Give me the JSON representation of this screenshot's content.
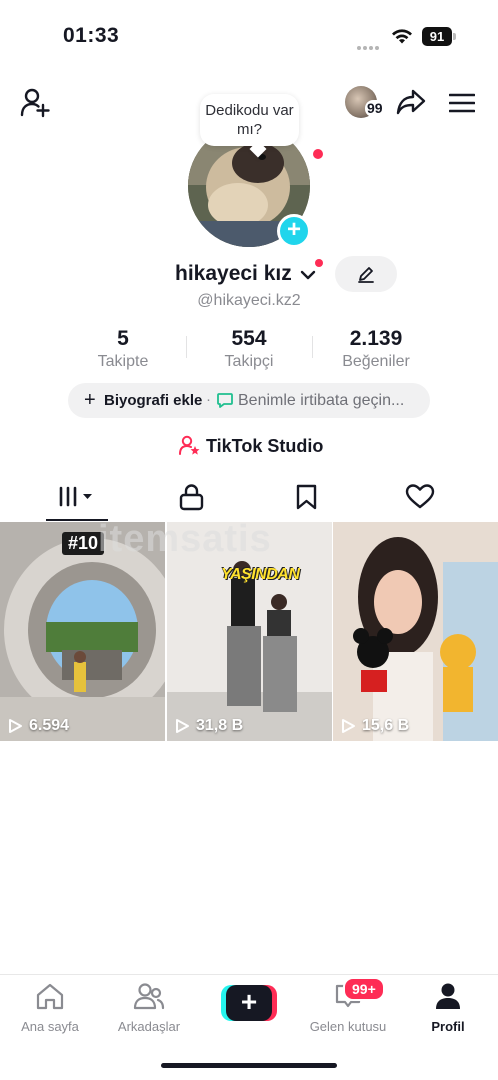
{
  "status_bar": {
    "time": "01:33",
    "battery": "91"
  },
  "top_bar": {
    "friends_badge": "99"
  },
  "profile": {
    "bubble_text": "Dedikodu var mı?",
    "username": "hikayeci kız",
    "handle": "@hikayeci.kz2",
    "stats": [
      {
        "value": "5",
        "label": "Takipte"
      },
      {
        "value": "554",
        "label": "Takipçi"
      },
      {
        "value": "2.139",
        "label": "Beğeniler"
      }
    ],
    "bio_add": "Biyografi ekle",
    "bio_separator": "·",
    "bio_contact": "Benimle irtibata geçin...",
    "studio": "TikTok Studio"
  },
  "videos": [
    {
      "views": "6.594",
      "tag": "#10"
    },
    {
      "views": "31,8 B",
      "caption": "YAŞINDAN"
    },
    {
      "views": "15,6 B"
    }
  ],
  "watermark": "itemsatis",
  "bottom_nav": {
    "home": "Ana sayfa",
    "friends": "Arkadaşlar",
    "inbox": "Gelen kutusu",
    "inbox_badge": "99+",
    "profile": "Profil"
  },
  "colors": {
    "accent": "#fe2c55",
    "cyan": "#25f4ee",
    "text": "#161823",
    "muted": "#8a8b91"
  }
}
